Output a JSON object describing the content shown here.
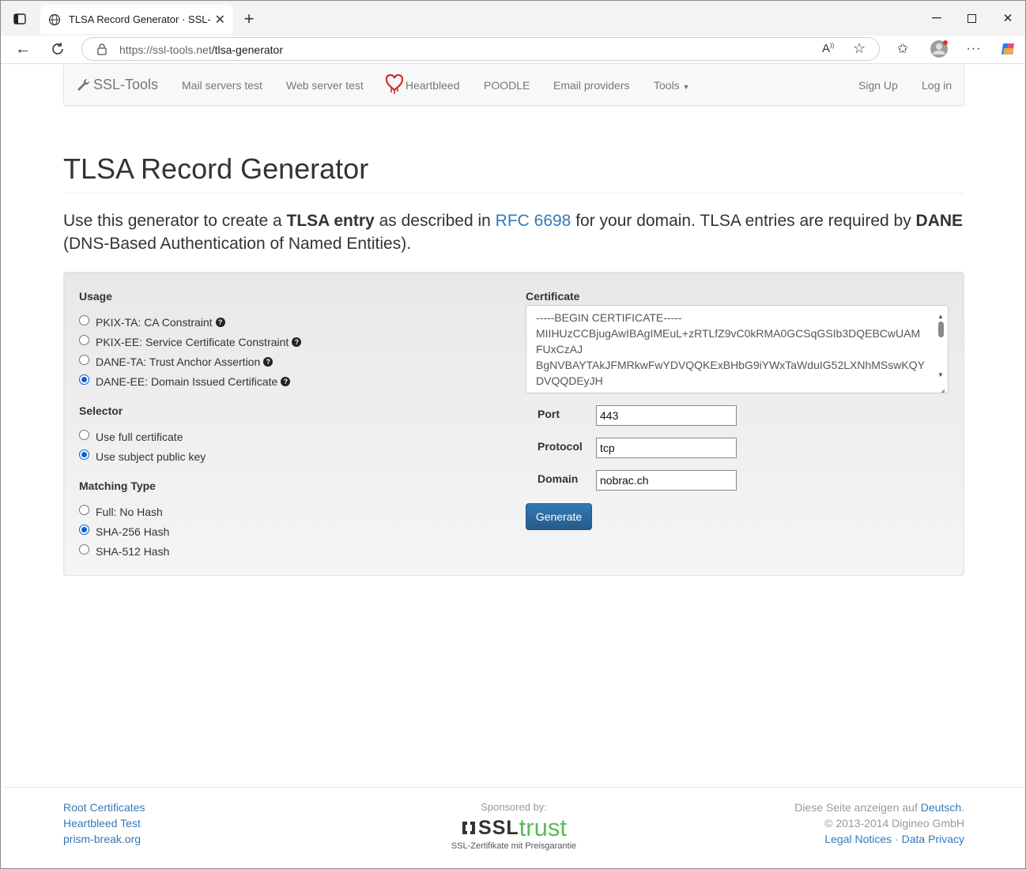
{
  "browser": {
    "tab_title": "TLSA Record Generator · SSL-Tools",
    "url_host": "https://ssl-tools.net",
    "url_path": "/tlsa-generator"
  },
  "nav": {
    "brand": "SSL-Tools",
    "links": [
      "Mail servers test",
      "Web server test",
      "Heartbleed",
      "POODLE",
      "Email providers",
      "Tools"
    ],
    "sign_up": "Sign Up",
    "log_in": "Log in"
  },
  "page": {
    "title": "TLSA Record Generator",
    "lead_1": "Use this generator to create a ",
    "lead_bold_1": "TLSA entry",
    "lead_2": " as described in ",
    "lead_link": "RFC 6698",
    "lead_3": " for your domain. TLSA entries are required by ",
    "lead_bold_2": "DANE",
    "lead_4": "(DNS-Based Authentication of Named Entities)."
  },
  "form": {
    "usage_label": "Usage",
    "usage": [
      "PKIX-TA: CA Constraint",
      "PKIX-EE: Service Certificate Constraint",
      "DANE-TA: Trust Anchor Assertion",
      "DANE-EE: Domain Issued Certificate"
    ],
    "usage_selected": "DANE-EE: Domain Issued Certificate",
    "selector_label": "Selector",
    "selector": [
      "Use full certificate",
      "Use subject public key"
    ],
    "selector_selected": "Use subject public key",
    "matching_label": "Matching Type",
    "matching": [
      "Full: No Hash",
      "SHA-256 Hash",
      "SHA-512 Hash"
    ],
    "matching_selected": "SHA-256 Hash",
    "certificate_label": "Certificate",
    "certificate_lines": [
      "-----BEGIN CERTIFICATE-----",
      "MIIHUzCCBjugAwIBAgIMEuL+zRTLfZ9vC0kRMA0GCSqGSIb3DQEBCwUAM",
      "FUxCzAJ",
      "BgNVBAYTAkJFMRkwFwYDVQQKExBHbG9iYWxTaWduIG52LXNhMSswKQY",
      "DVQQDEyJH"
    ],
    "port_label": "Port",
    "port_value": "443",
    "protocol_label": "Protocol",
    "protocol_value": "tcp",
    "domain_label": "Domain",
    "domain_value": "nobrac.ch",
    "generate": "Generate"
  },
  "footer": {
    "left_links": [
      "Root Certificates",
      "Heartbleed Test",
      "prism-break.org"
    ],
    "sponsored": "Sponsored by:",
    "sponsor_logo_a": "SSL",
    "sponsor_logo_b": "trust",
    "sponsor_tagline": "SSL-Zertifikate mit Preisgarantie",
    "lang_text": "Diese Seite anzeigen auf ",
    "lang_link": "Deutsch",
    "copyright": "© 2013-2014 Digineo GmbH",
    "legal": "Legal Notices",
    "privacy": "Data Privacy"
  }
}
